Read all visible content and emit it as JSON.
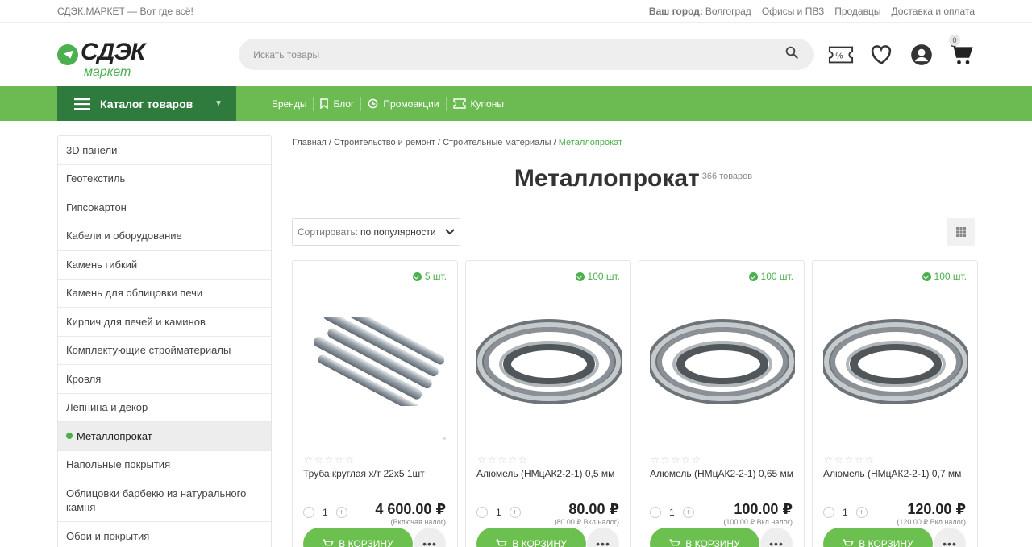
{
  "topbar": {
    "site_label": "СДЭК.МАРКЕТ — Вот где всё!",
    "city_label": "Ваш город:",
    "city_value": "Волгоград",
    "links": [
      "Офисы и ПВЗ",
      "Продавцы",
      "Доставка и оплата"
    ]
  },
  "logo": {
    "word": "СДЭК",
    "sub": "маркет"
  },
  "search": {
    "placeholder": "Искать товары"
  },
  "cart": {
    "count": "0"
  },
  "nav": {
    "catalog_label": "Каталог товаров",
    "links": [
      "Бренды",
      "Блог",
      "Промоакции",
      "Купоны"
    ]
  },
  "sidebar": {
    "items": [
      "3D панели",
      "Геотекстиль",
      "Гипсокартон",
      "Кабели и оборудование",
      "Камень гибкий",
      "Камень для облицовки печи",
      "Кирпич для печей и каминов",
      "Комплектующие стройматериалы",
      "Кровля",
      "Лепнина и декор",
      "Металлопрокат",
      "Напольные покрытия",
      "Облицовки барбекю из натурального камня",
      "Обои и покрытия"
    ]
  },
  "breadcrumbs": [
    "Главная",
    "Строительство и ремонт",
    "Строительные материалы",
    "Металлопрокат"
  ],
  "page": {
    "title": "Металлопрокат",
    "count": "366 товаров"
  },
  "sort": {
    "label": "Сортировать:",
    "value": "по популярности"
  },
  "products": [
    {
      "stock": "5 шт.",
      "name": "Труба круглая х/т 22х5 1шт",
      "qty": "1",
      "price": "4 600.00",
      "tax": "(Включая налог)",
      "cart_label": "В КОРЗИНУ",
      "image": "pipes"
    },
    {
      "stock": "100 шт.",
      "name": "Алюмель (НМцАК2-2-1) 0,5 мм",
      "qty": "1",
      "price": "80.00",
      "tax": "(80.00 ₽ Вкл налог)",
      "cart_label": "В КОРЗИНУ",
      "image": "wire-coil"
    },
    {
      "stock": "100 шт.",
      "name": "Алюмель (НМцАК2-2-1) 0,65 мм",
      "qty": "1",
      "price": "100.00",
      "tax": "(100.00 ₽ Вкл налог)",
      "cart_label": "В КОРЗИНУ",
      "image": "wire-coil"
    },
    {
      "stock": "100 шт.",
      "name": "Алюмель (НМцАК2-2-1) 0,7 мм",
      "qty": "1",
      "price": "120.00",
      "tax": "(120.00 ₽ Вкл налог)",
      "cart_label": "В КОРЗИНУ",
      "image": "wire-coil"
    }
  ],
  "currency": "₽",
  "colors": {
    "accent": "#6cba52",
    "catalog_bg": "#2f7a3d",
    "brand_green": "#4caf50"
  }
}
